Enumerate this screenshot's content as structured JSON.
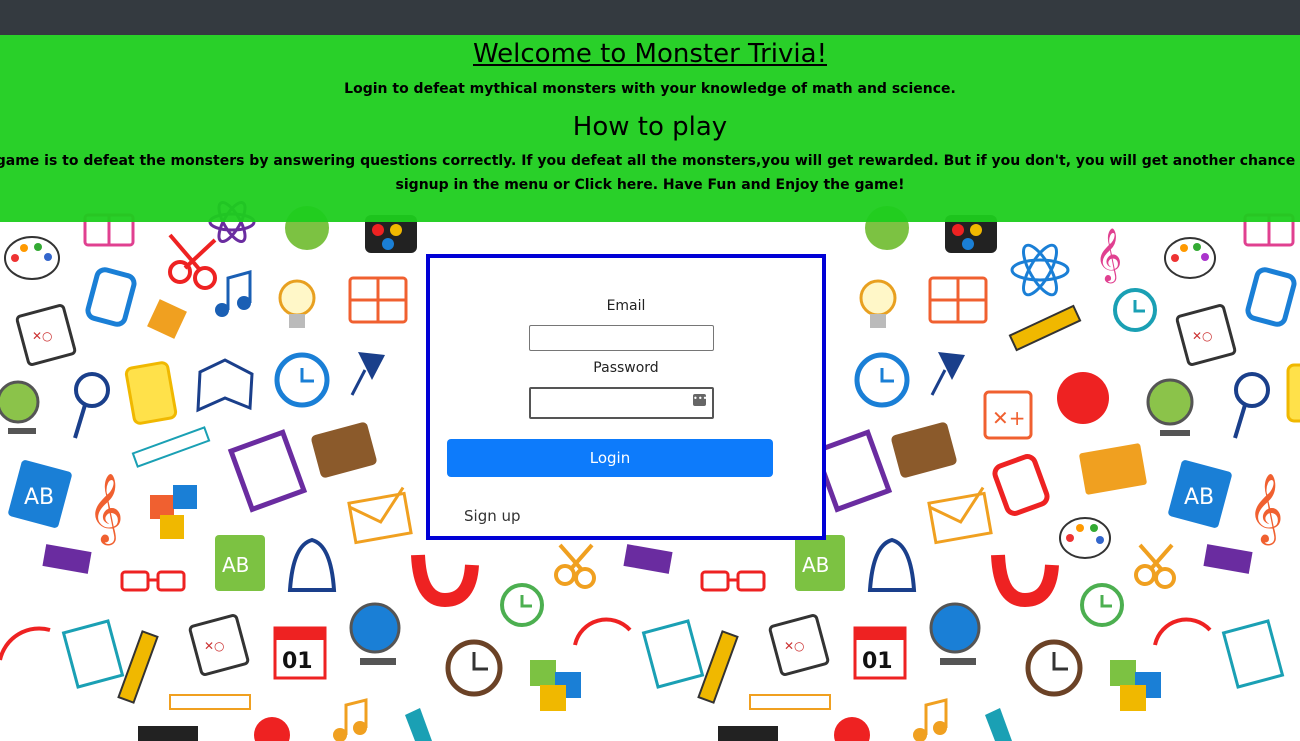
{
  "banner": {
    "title": "Welcome to Monster Trivia!",
    "subtitle": "Login to defeat mythical monsters with your knowledge of math and science.",
    "howto_heading": "How to play",
    "howto_line1": "The aim of the game is to defeat the monsters by answering questions correctly. If you defeat all the monsters,you will get rewarded. But if you don't, you will get another chance to defeat them.",
    "howto_line2": "signup in the menu or Click here. Have Fun and Enjoy the game!"
  },
  "login": {
    "email_label": "Email",
    "email_value": "",
    "password_label": "Password",
    "password_value": "",
    "login_button": "Login",
    "signup_link": "Sign up"
  },
  "colors": {
    "topbar": "#343a40",
    "banner": "#1ecd1e",
    "card_border": "#0000d6",
    "login_button": "#0d7bfb"
  }
}
